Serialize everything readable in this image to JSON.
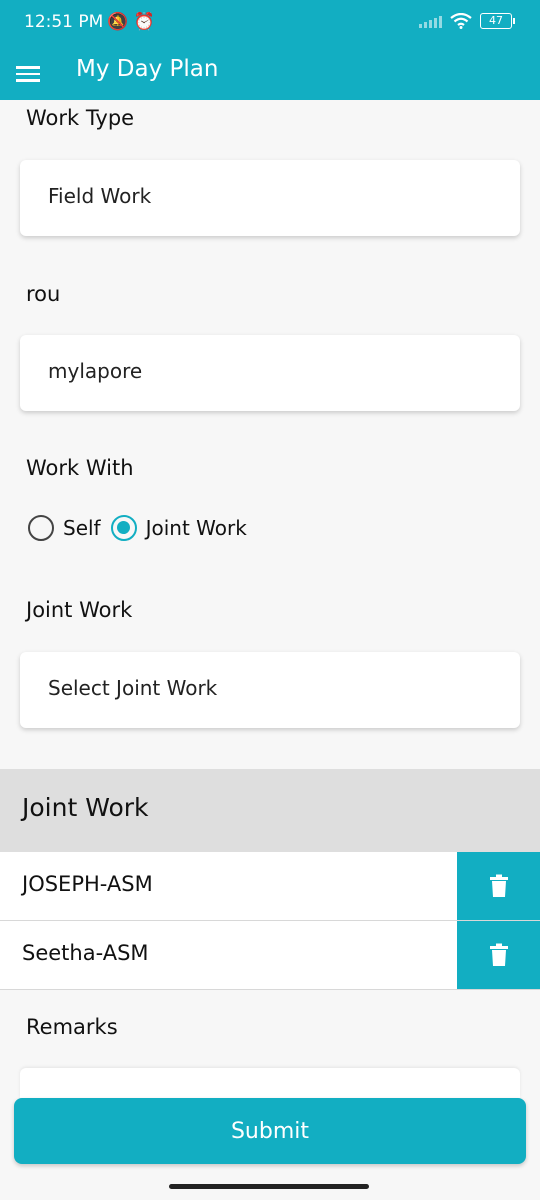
{
  "status_bar": {
    "time": "12:51 PM",
    "icons": "🔕 ⏰",
    "battery": "47"
  },
  "app_bar": {
    "title": "My Day Plan",
    "menu_icon": "hamburger-menu-icon"
  },
  "form": {
    "work_type": {
      "label": "Work Type",
      "value": "Field Work"
    },
    "route": {
      "label": "rou",
      "value": "mylapore"
    },
    "work_with": {
      "label": "Work With",
      "options": [
        "Self",
        "Joint Work"
      ],
      "selected": "Joint Work"
    },
    "joint_work_select": {
      "label": "Joint Work",
      "placeholder": "Select Joint Work"
    }
  },
  "joint_work_list": {
    "header": "Joint Work",
    "items": [
      "JOSEPH-ASM",
      "Seetha-ASM"
    ],
    "delete_icon": "trash-icon"
  },
  "remarks": {
    "label": "Remarks"
  },
  "submit_label": "Submit",
  "colors": {
    "accent": "#12aec2",
    "header_gray": "#dedede",
    "background": "#f7f7f7"
  }
}
